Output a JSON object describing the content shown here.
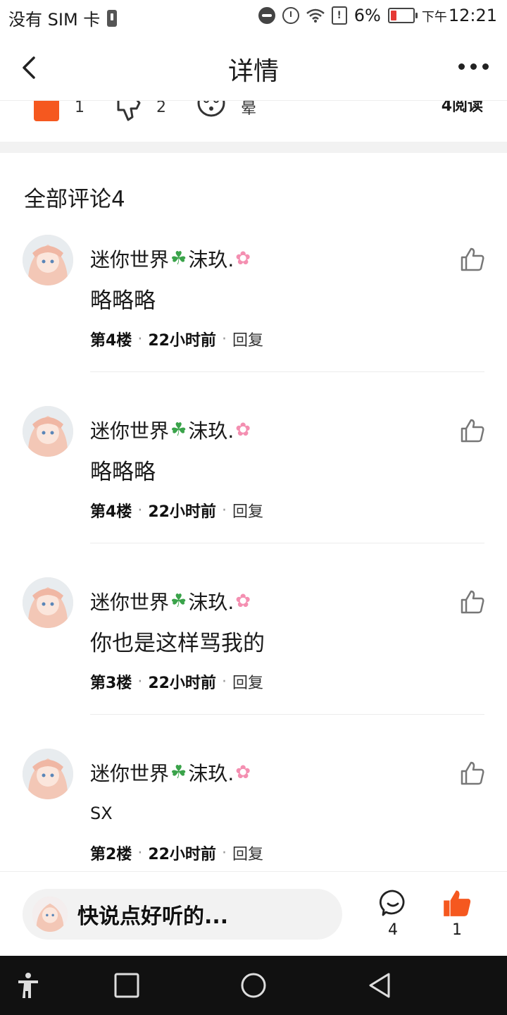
{
  "status_bar": {
    "carrier": "没有 SIM 卡",
    "battery": "6%",
    "ampm": "下午",
    "time": "12:21",
    "icons": [
      "sim-icon",
      "dnd-icon",
      "alarm-icon",
      "wifi-icon",
      "alert-icon",
      "battery-icon"
    ]
  },
  "header": {
    "title": "详情",
    "back_icon": "chevron-left-icon",
    "more_icon": "more-dots-icon"
  },
  "reactions": {
    "like_count": "1",
    "dislike_count": "2",
    "dizzy_label": "晕",
    "views": "4阅读",
    "accent_color": "#f5581f"
  },
  "comments_section": {
    "title": "全部评论4",
    "items": [
      {
        "user": "迷你世界",
        "user_suffix": "沫玖.",
        "text": "略略略",
        "floor": "第4楼",
        "time": "22小时前",
        "reply": "回复"
      },
      {
        "user": "迷你世界",
        "user_suffix": "沫玖.",
        "text": "略略略",
        "floor": "第4楼",
        "time": "22小时前",
        "reply": "回复"
      },
      {
        "user": "迷你世界",
        "user_suffix": "沫玖.",
        "text": "你也是这样骂我的",
        "floor": "第3楼",
        "time": "22小时前",
        "reply": "回复"
      },
      {
        "user": "迷你世界",
        "user_suffix": "沫玖.",
        "text": "SX",
        "floor": "第2楼",
        "time": "22小时前",
        "reply": "回复"
      }
    ],
    "meta_separator": "·"
  },
  "bottom_bar": {
    "input_placeholder": "快说点好听的...",
    "comment_count": "4",
    "like_count": "1"
  }
}
